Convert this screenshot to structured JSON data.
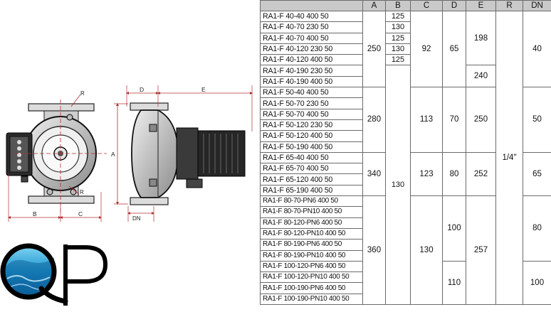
{
  "logo": {
    "text": "QP"
  },
  "dimension_labels": {
    "A": "A",
    "B": "B",
    "C": "C",
    "D": "D",
    "E": "E",
    "R": "R",
    "DN": "DN"
  },
  "table": {
    "headers": [
      "A",
      "B",
      "C",
      "D",
      "E",
      "R",
      "DN"
    ],
    "models": [
      "RA1-F 40-40 400 50",
      "RA1-F 40-70 230 50",
      "RA1-F 40-70 400 50",
      "RA1-F 40-120 230 50",
      "RA1-F 40-120 400 50",
      "RA1-F 40-190 230 50",
      "RA1-F 40-190 400 50",
      "RA1-F 50-40 400 50",
      "RA1-F 50-70 230 50",
      "RA1-F 50-70 400 50",
      "RA1-F 50-120 230 50",
      "RA1-F 50-120 400 50",
      "RA1-F 50-190 400 50",
      "RA1-F 65-40 400 50",
      "RA1-F 65-70 400 50",
      "RA1-F 65-120 400 50",
      "RA1-F 65-190 400 50",
      "RA1-F 80-70-PN6 400 50",
      "RA1-F 80-70-PN10 400 50",
      "RA1-F 80-120-PN6 400 50",
      "RA1-F 80-120-PN10 400 50",
      "RA1-F 80-190-PN6 400 50",
      "RA1-F 80-190-PN10 400 50",
      "RA1-F 100-120-PN6 400 50",
      "RA1-F 100-120-PN10 400 50",
      "RA1-F 100-190-PN6 400 50",
      "RA1-F 100-190-PN10 400 50"
    ],
    "A": [
      "250",
      "280",
      "340",
      "360"
    ],
    "B": [
      "125",
      "130",
      "125",
      "130",
      "125",
      "130"
    ],
    "C": [
      "92",
      "113",
      "123",
      "130"
    ],
    "D": [
      "65",
      "70",
      "80",
      "100",
      "110"
    ],
    "E": [
      "198",
      "240",
      "250",
      "252",
      "257"
    ],
    "R": "1/4\"",
    "DN": [
      "40",
      "50",
      "65",
      "80",
      "100"
    ]
  }
}
